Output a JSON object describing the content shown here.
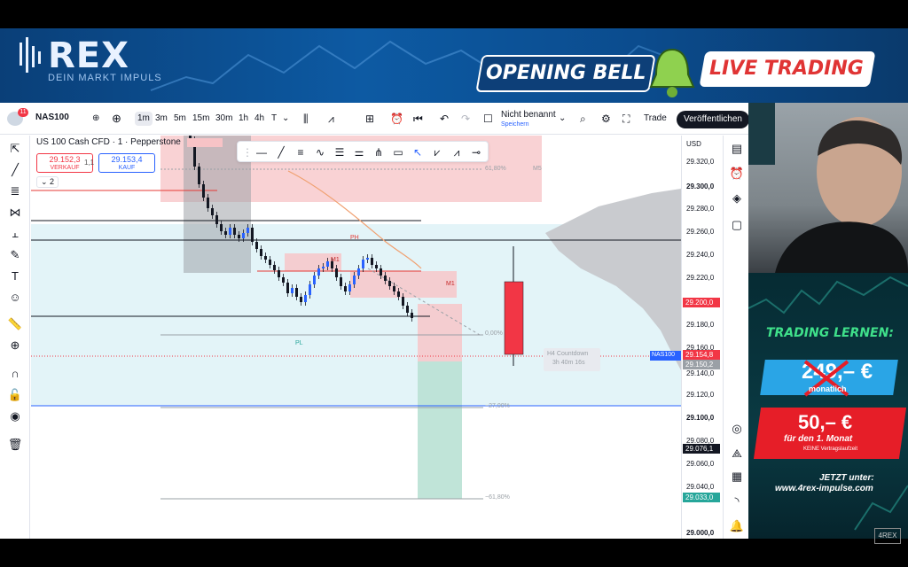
{
  "banner": {
    "logo_title": "REX",
    "logo_subtitle": "DEIN MARKT IMPULS",
    "opening_bell": "OPENING BELL",
    "live_trading": "LIVE TRADING"
  },
  "topbar": {
    "notifications": "11",
    "symbol": "NAS100",
    "timeframes": [
      "1m",
      "3m",
      "5m",
      "15m",
      "30m",
      "1h",
      "4h",
      "T"
    ],
    "active_timeframe": "1m",
    "layout_name": "Nicht benannt",
    "layout_status": "Speichern",
    "trade": "Trade",
    "publish": "Veröffentlichen"
  },
  "legend": {
    "title": "US 100 Cash CFD · 1 · Pepperstone",
    "sell_price": "29.152,3",
    "sell_label": "VERKAUF",
    "spread": "1,1",
    "buy_price": "29.153,4",
    "buy_label": "KAUF",
    "collapse": "2"
  },
  "chart_labels": {
    "fib_618_top": "61,80%",
    "fib_0": "0,00%",
    "fib_neg27": "−27,00%",
    "fib_neg618": "−61,80%",
    "m5": "M5",
    "m1a": "M1",
    "m1b": "M1",
    "ph": "PH",
    "pl": "PL",
    "countdown_title": "H4 Countdown",
    "countdown_value": "3h 40m 16s",
    "symbol_tag": "NAS100"
  },
  "price_axis": {
    "currency": "USD",
    "labels": [
      "29.320,0",
      "29.300,0",
      "29.280,0",
      "29.260,0",
      "29.240,0",
      "29.220,0",
      "29.180,0",
      "29.160,0",
      "29.140,0",
      "29.120,0",
      "29.100,0",
      "29.080,0",
      "29.060,0",
      "29.040,0",
      "29.000,0"
    ],
    "tag_red": "29.200,0",
    "tag_price": "29.154,8",
    "tag_price2": "29.150,2",
    "tag_dark": "29.076,1",
    "tag_green": "29.033,0"
  },
  "promo": {
    "headline": "TRADING LERNEN:",
    "old_price": "249,– €",
    "old_period": "monatlich",
    "new_price": "50,– €",
    "new_period": "für den 1. Monat",
    "note": "KEINE Vertragslaufzeit",
    "cta": "JETZT unter:",
    "url": "www.4rex-impulse.com"
  },
  "corner_logo": "4REX",
  "colors": {
    "bull": "#2962ff",
    "bear": "#131722",
    "red_zone": "#f7c3c6",
    "green_zone": "#b9e1d4",
    "banner": "#0b4c8e"
  }
}
